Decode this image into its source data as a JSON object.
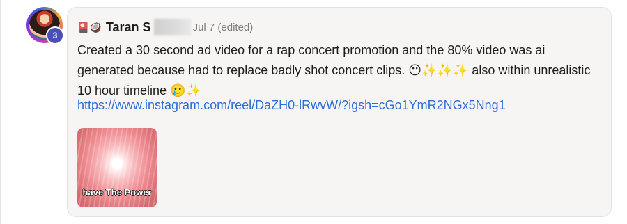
{
  "post": {
    "author": {
      "emoji": "🎴🥥",
      "name": "Taran S",
      "badge_count": "3"
    },
    "meta": {
      "date": "Jul 7",
      "edited_label": "(edited)"
    },
    "message": {
      "line1": "Created a 30 second ad video for a rap concert promotion and the 80% video was ai",
      "line2": "generated because had to replace badly shot concert clips. 😶✨✨✨ also within unrealistic",
      "line3": "10 hour timeline 🥲✨"
    },
    "link": {
      "text": "https://www.instagram.com/reel/DaZH0-lRwvW/?igsh=cGo1YmR2NGx5Nng1"
    },
    "attachment": {
      "caption": "have The Power"
    }
  },
  "colors": {
    "bubble_bg": "#f6f5f4",
    "link": "#2d6ed6",
    "badge": "#4a4fb6"
  },
  "icons": [
    "avatar-image",
    "notification-badge"
  ]
}
